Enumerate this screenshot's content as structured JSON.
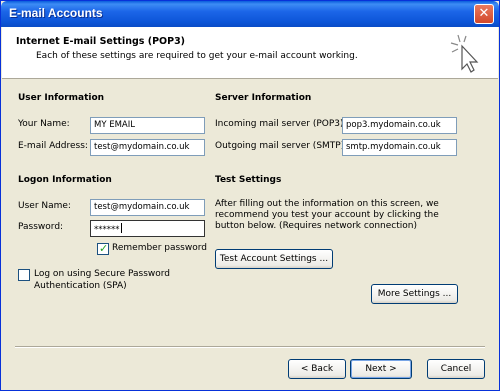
{
  "window": {
    "title": "E-mail Accounts",
    "close_glyph": "✕"
  },
  "header": {
    "title": "Internet E-mail Settings (POP3)",
    "subtitle": "Each of these settings are required to get your e-mail account working.",
    "icon": "cursor-click-icon"
  },
  "user_info": {
    "heading": "User Information",
    "name_label": "Your Name:",
    "name_value": "MY EMAIL",
    "email_label": "E-mail Address:",
    "email_value": "test@mydomain.co.uk"
  },
  "server_info": {
    "heading": "Server Information",
    "incoming_label": "Incoming mail server (POP3):",
    "incoming_value": "pop3.mydomain.co.uk",
    "outgoing_label": "Outgoing mail server (SMTP):",
    "outgoing_value": "smtp.mydomain.co.uk"
  },
  "logon_info": {
    "heading": "Logon Information",
    "username_label": "User Name:",
    "username_value": "test@mydomain.co.uk",
    "password_label": "Password:",
    "password_value": "******",
    "remember_label": "Remember password",
    "remember_checked": true,
    "spa_label_line1": "Log on using Secure Password",
    "spa_label_line2": "Authentication (SPA)",
    "spa_checked": false
  },
  "test_settings": {
    "heading": "Test Settings",
    "description_line1": "After filling out the information on this screen, we",
    "description_line2": "recommend you test your account by clicking the",
    "description_line3": "button below. (Requires network connection)",
    "test_button": "Test Account Settings ..."
  },
  "more_settings_button": "More Settings ...",
  "footer": {
    "back": "< Back",
    "next": "Next >",
    "cancel": "Cancel"
  }
}
